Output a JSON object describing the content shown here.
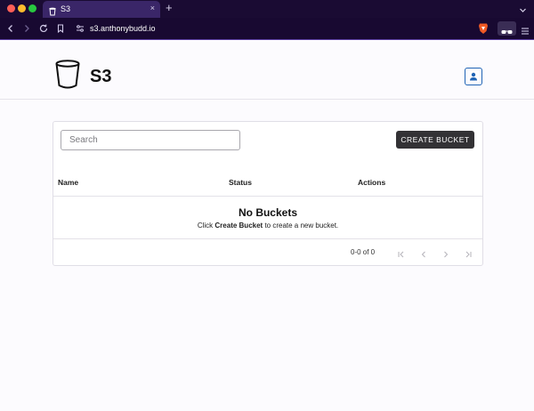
{
  "browser": {
    "tab_title": "S3",
    "new_tab": "+",
    "tab_close": "×",
    "url": "s3.anthonybudd.io",
    "colors": {
      "chrome": "#1a0b33",
      "tab": "#3a2668",
      "accent": "#5a3fa0"
    }
  },
  "header": {
    "title": "S3",
    "logo_icon": "bucket-icon",
    "user_icon": "user-icon"
  },
  "toolbar": {
    "search_placeholder": "Search",
    "create_label": "CREATE BUCKET"
  },
  "table": {
    "columns": [
      "Name",
      "Status",
      "Actions"
    ],
    "rows": []
  },
  "empty": {
    "title": "No Buckets",
    "msg_prefix": "Click ",
    "msg_bold": "Create Bucket",
    "msg_suffix": " to create a new bucket."
  },
  "pagination": {
    "range": "0-0 of 0"
  }
}
